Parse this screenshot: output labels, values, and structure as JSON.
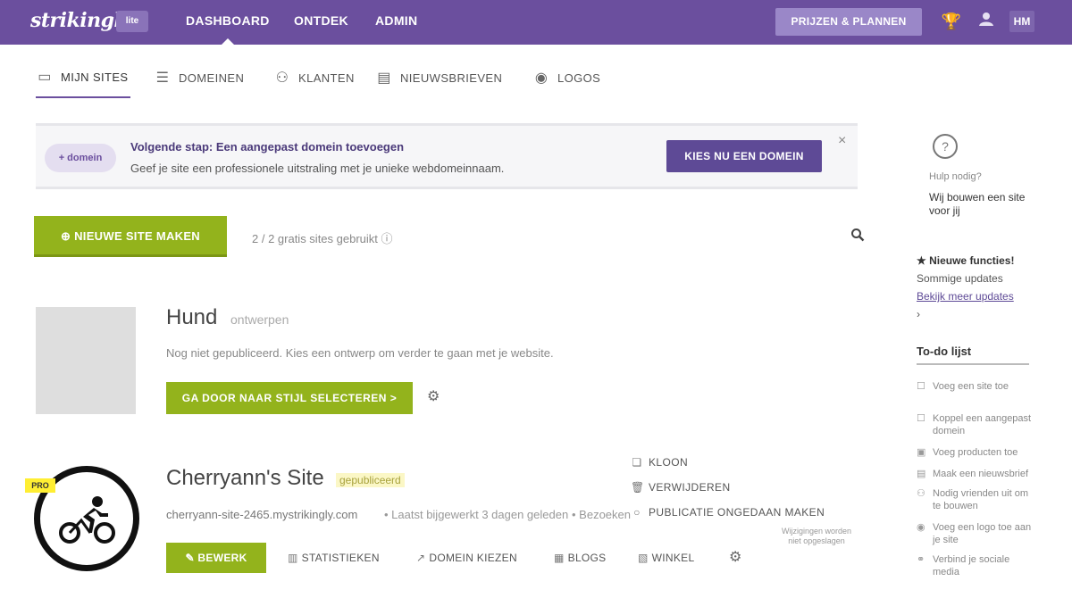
{
  "app": {
    "logo_text": "strikingly",
    "logo_badge": "lite"
  },
  "topnav": {
    "items": [
      "DASHBOARD",
      "ONTDEK",
      "ADMIN"
    ],
    "pricing_button": "PRIJZEN & PLANNEN",
    "avatar_initials": "HM",
    "icons": [
      "trophy-icon",
      "user-icon"
    ]
  },
  "subnav": {
    "tabs": [
      {
        "label": "MIJN SITES",
        "icon": "monitor-icon",
        "active": true
      },
      {
        "label": "DOMEINEN",
        "icon": "domains-icon",
        "active": false
      },
      {
        "label": "KLANTEN",
        "icon": "customers-icon",
        "active": false
      },
      {
        "label": "NIEUWSBRIEVEN",
        "icon": "newsletter-icon",
        "active": false
      },
      {
        "label": "LOGOS",
        "icon": "palette-icon",
        "active": false
      }
    ]
  },
  "banner": {
    "chip_label": "+ domein",
    "title": "Volgende stap: Een aangepast domein toevoegen",
    "text": "Geef je site een professionele uitstraling met je unieke webdomeinnaam.",
    "cta_label": "KIES NU EEN DOMEIN",
    "close_glyph": "×"
  },
  "toolbar": {
    "new_site_label": "NIEUWE SITE MAKEN",
    "site_count": "2 / 2 gratis sites gebruikt"
  },
  "sites": [
    {
      "name": "Hund",
      "status": "ontwerpen",
      "description": "Nog niet gepubliceerd. Kies een ontwerp om verder te gaan met je website.",
      "continue_label": "GA DOOR NAAR STIJL SELECTEREN >"
    },
    {
      "name": "Cherryann's Site",
      "badge": "gepubliceerd",
      "pro_label": "PRO",
      "url": "cherryann-site-2465.mystrikingly.com",
      "meta": "• Laatst bijgewerkt 3 dagen geleden",
      "extra": "• Bezoeken",
      "edit_label": "✎ BEWERK",
      "actions": [
        {
          "label": "STATISTIEKEN",
          "icon": "stats-icon"
        },
        {
          "label": "DOMEIN KIEZEN",
          "icon": "domain-icon"
        },
        {
          "label": "BLOGS",
          "icon": "blog-icon"
        },
        {
          "label": "WINKEL",
          "icon": "store-icon"
        }
      ],
      "dropdown": [
        {
          "label": "KLOON",
          "icon": "clone-icon"
        },
        {
          "label": "VERWIJDEREN",
          "icon": "trash-icon"
        },
        {
          "label": "PUBLICATIE ONGEDAAN MAKEN",
          "icon": "unpublish-icon"
        }
      ],
      "dropdown_note": "Wijzigingen worden niet opgeslagen"
    }
  ],
  "sidebar": {
    "help_small": "Hulp nodig?",
    "help_text": "Wij bouwen een site voor jij",
    "news_head": "★ Nieuwe functies!",
    "news_line": "Sommige updates",
    "news_link": "Bekijk meer updates",
    "news_arrow": "›",
    "todo_title": "To-do lijst",
    "todo_items": [
      "Voeg een site toe",
      "Koppel een aangepast domein",
      "Voeg producten toe",
      "Maak een nieuwsbrief",
      "Nodig vrienden uit om te bouwen",
      "Voeg een logo toe aan je site",
      "Verbind je sociale media"
    ]
  },
  "colors": {
    "brand_purple": "#6b4f9e",
    "action_green": "#93b31c",
    "cta_purple": "#5e4a96"
  }
}
